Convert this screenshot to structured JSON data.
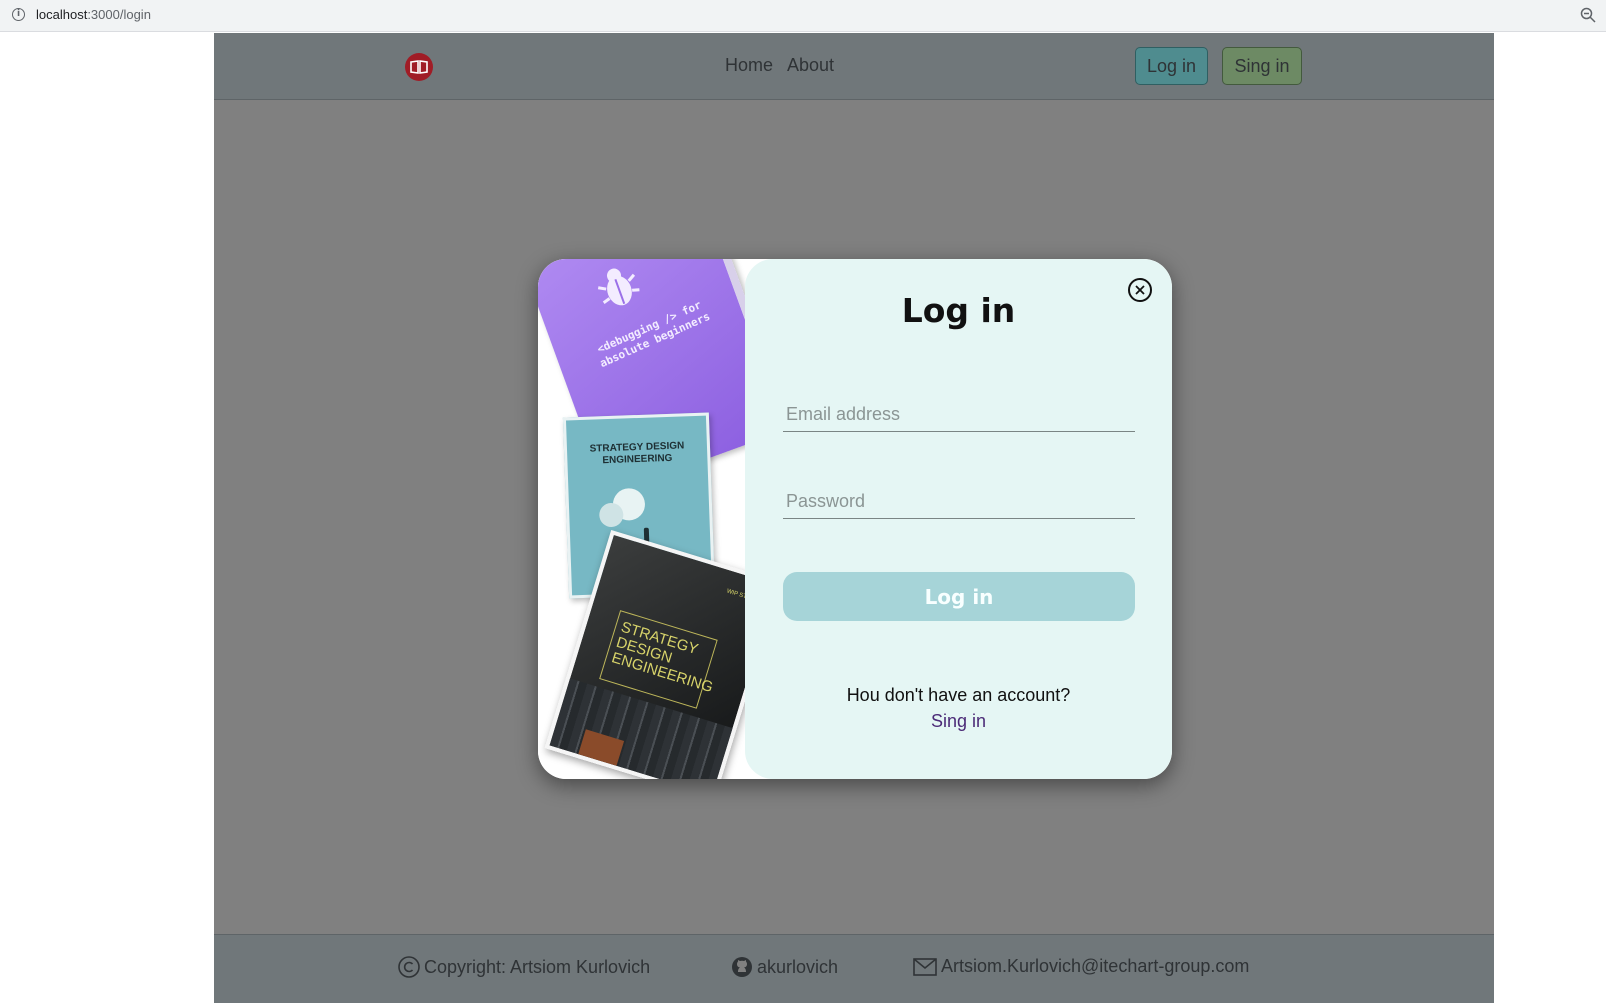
{
  "browser": {
    "url_host": "localhost",
    "url_path": ":3000/login"
  },
  "navbar": {
    "links": [
      {
        "label": "Home"
      },
      {
        "label": "About"
      }
    ],
    "login_label": "Log in",
    "signin_label": "Sing in"
  },
  "modal": {
    "title": "Log in",
    "email_placeholder": "Email address",
    "password_placeholder": "Password",
    "submit_label": "Log in",
    "no_account_text": "Hou don't have an account?",
    "signin_link": "Sing in",
    "book_covers": {
      "purple_text": "<debugging /> for absolute beginners",
      "teal_title": "STRATEGY DESIGN ENGINEERING",
      "black_studio": "WIP STUDIO",
      "black_title": "STRATEGY DESIGN ENGINEERING"
    }
  },
  "footer": {
    "copyright": "Copyright: Artsiom Kurlovich",
    "github": "akurlovich",
    "email": "Artsiom.Kurlovich@itechart-group.com"
  },
  "colors": {
    "navbar_bg": "#70777a",
    "overlay_bg": "#808080",
    "panel_bg": "#e5f6f4",
    "login_button": "#4f8c8f",
    "signin_button": "#6d8a64",
    "submit_button": "#a6d4d8",
    "link": "#4b2a77",
    "logo": "#a01c26"
  },
  "icons": [
    "info-icon",
    "zoom-icon",
    "book-logo-icon",
    "close-icon",
    "copyright-icon",
    "github-icon",
    "mail-icon"
  ]
}
